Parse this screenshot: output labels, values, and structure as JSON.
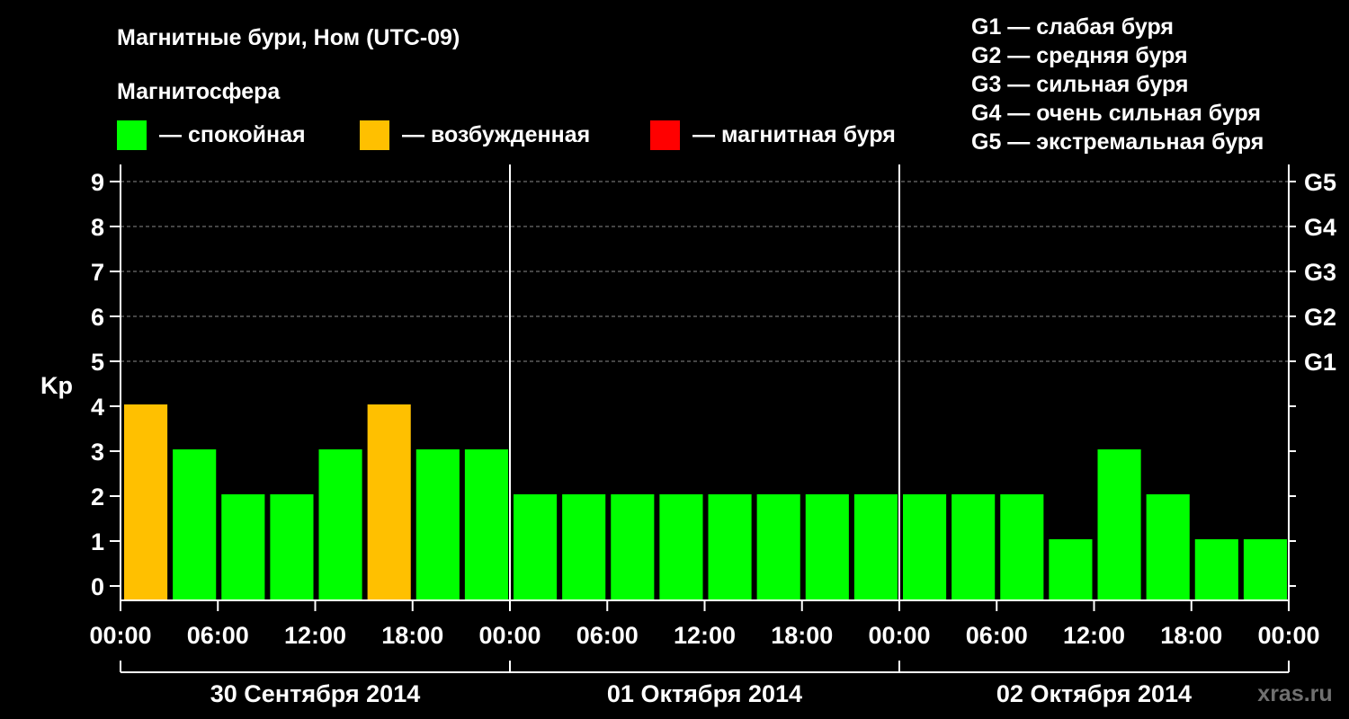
{
  "chart_data": {
    "type": "bar",
    "title": "Магнитные бури, Ном (UTC-09)",
    "subtitle": "Магнитосфера",
    "ylabel": "Kp",
    "ylim": [
      0,
      9
    ],
    "yticks": [
      "0",
      "1",
      "2",
      "3",
      "4",
      "5",
      "6",
      "7",
      "8",
      "9"
    ],
    "right_ticks": [
      "G1",
      "G2",
      "G3",
      "G4",
      "G5"
    ],
    "x_ticks": [
      "00:00",
      "06:00",
      "12:00",
      "18:00",
      "00:00",
      "06:00",
      "12:00",
      "18:00",
      "00:00",
      "06:00",
      "12:00",
      "18:00",
      "00:00"
    ],
    "days": [
      "30 Сентября 2014",
      "01 Октября 2014",
      "02 Октября 2014"
    ],
    "values": [
      4,
      3,
      2,
      2,
      3,
      4,
      3,
      3,
      2,
      2,
      2,
      2,
      2,
      2,
      2,
      2,
      2,
      2,
      2,
      1,
      3,
      2,
      1,
      1
    ],
    "legend": [
      {
        "label": "— спокойная",
        "color": "#00ff00"
      },
      {
        "label": "— возбужденная",
        "color": "#ffc000"
      },
      {
        "label": "— магнитная буря",
        "color": "#ff0000"
      }
    ],
    "scale_legend": [
      "G1 — слабая буря",
      "G2 — средняя буря",
      "G3 — сильная буря",
      "G4 — очень сильная буря",
      "G5 — экстремальная буря"
    ],
    "grid": true,
    "watermark": "xras.ru"
  }
}
